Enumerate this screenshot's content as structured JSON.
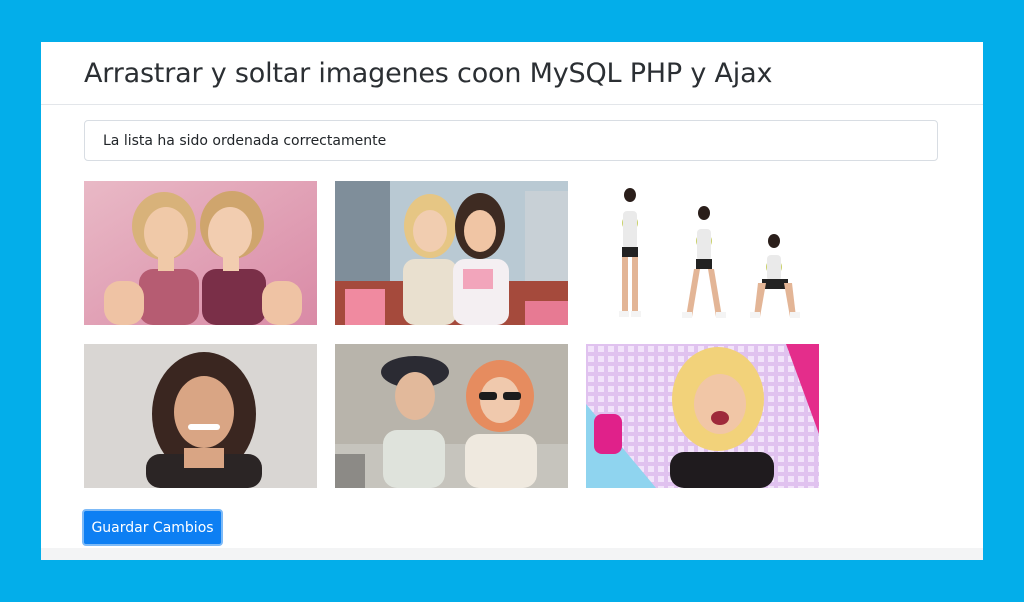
{
  "page": {
    "title": "Arrastrar y soltar imagenes coon MySQL PHP y Ajax",
    "alert_message": "La lista ha sido ordenada correctamente",
    "save_button_label": "Guardar Cambios"
  },
  "gallery": {
    "items": [
      {
        "description": "two-blonde-girls-photo"
      },
      {
        "description": "two-women-rooftop-photo"
      },
      {
        "description": "woman-squat-exercise-sequence-photo"
      },
      {
        "description": "smiling-woman-portrait-photo"
      },
      {
        "description": "two-women-vintage-car-photo"
      },
      {
        "description": "excited-blonde-woman-photo"
      }
    ]
  },
  "colors": {
    "page_background": "#03aeea",
    "card_background": "#ffffff",
    "button_primary": "#0d7ff3"
  }
}
